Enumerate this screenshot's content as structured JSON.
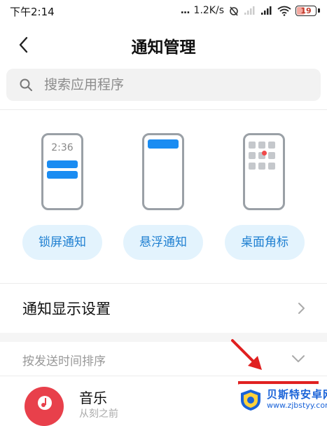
{
  "status_bar": {
    "time": "下午2:14",
    "network_dots": "...",
    "net_speed": "1.2K/s",
    "battery": "19"
  },
  "header": {
    "title": "通知管理"
  },
  "search": {
    "placeholder": "搜索应用程序"
  },
  "styles": {
    "lock_preview_time": "2:36",
    "buttons": [
      {
        "label": "锁屏通知"
      },
      {
        "label": "悬浮通知"
      },
      {
        "label": "桌面角标"
      }
    ]
  },
  "settings_row": {
    "label": "通知显示设置"
  },
  "sort": {
    "label": "按发送时间排序"
  },
  "apps": [
    {
      "name": "音乐",
      "subtitle": "从刻之前"
    }
  ],
  "watermark": {
    "title": "贝斯特安卓网",
    "url": "www.zjbstyy.com"
  },
  "colors": {
    "accent": "#1a8cf2",
    "pill_bg": "#e3f3fd",
    "pill_text": "#1e7fd1",
    "music_icon": "#e8404b",
    "annotation": "#e02020"
  }
}
